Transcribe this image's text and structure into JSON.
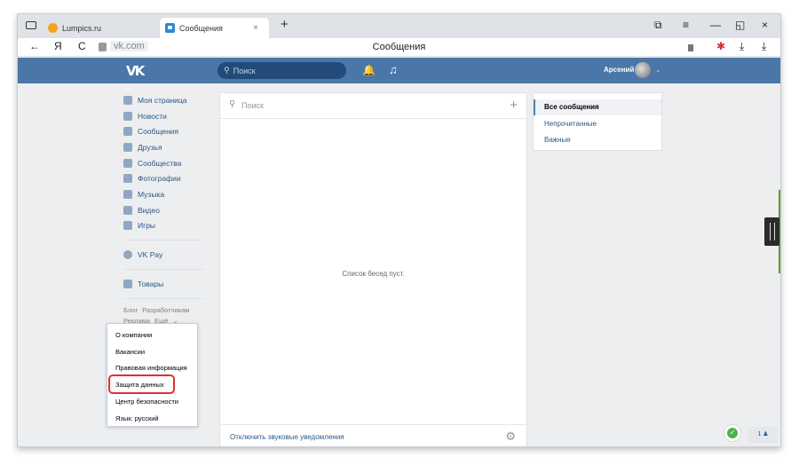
{
  "browser": {
    "tabs": [
      {
        "label": "Lumpics.ru",
        "icon": "lumpics-favicon"
      },
      {
        "label": "Сообщения",
        "icon": "vk-favicon"
      }
    ],
    "tab_close_glyph": "×",
    "new_tab_glyph": "+",
    "address": {
      "domain": "vk.com",
      "page_title": "Сообщения",
      "back_glyph": "←",
      "yandex_glyph": "Я",
      "reload_glyph": "C"
    },
    "window_controls": {
      "list": "≡",
      "minimize": "—",
      "restore": "◱",
      "close": "×",
      "pin": "⧉"
    },
    "toolbar_icons": {
      "bug": "✱",
      "save": "⤓",
      "download": "⤓"
    }
  },
  "vk_header": {
    "logo": "VK",
    "search_placeholder": "Поиск",
    "search_glyph": "⚲",
    "bell_glyph": "🔔",
    "music_glyph": "♫",
    "user_name": "Арсений",
    "caret": "⌄"
  },
  "left_nav": {
    "items": [
      {
        "label": "Моя страница",
        "icon": "home-icon"
      },
      {
        "label": "Новости",
        "icon": "news-icon"
      },
      {
        "label": "Сообщения",
        "icon": "messages-icon"
      },
      {
        "label": "Друзья",
        "icon": "friends-icon"
      },
      {
        "label": "Сообщества",
        "icon": "communities-icon"
      },
      {
        "label": "Фотографии",
        "icon": "photos-icon"
      },
      {
        "label": "Музыка",
        "icon": "music-icon"
      },
      {
        "label": "Видео",
        "icon": "video-icon"
      },
      {
        "label": "Игры",
        "icon": "games-icon"
      }
    ],
    "vkpay": {
      "label": "VK Pay",
      "icon": "vkpay-icon"
    },
    "goods": {
      "label": "Товары",
      "icon": "goods-icon"
    },
    "small_links": {
      "blog": "Блог",
      "developers": "Разработчикам",
      "ads": "Реклама",
      "more": "Ещё"
    }
  },
  "dropdown": {
    "items": [
      "О компании",
      "Вакансии",
      "Правовая информация",
      "Защита данных",
      "Центр безопасности",
      "Язык: русский"
    ]
  },
  "messages": {
    "search_placeholder": "Поиск",
    "search_glyph": "⚲",
    "add_glyph": "+",
    "empty_text": "Список бесед пуст.",
    "footer_label": "Отключить звуковые уведомления",
    "gear_glyph": "⚙"
  },
  "filters": {
    "items": [
      {
        "label": "Все сообщения",
        "active": true
      },
      {
        "label": "Непрочитанные",
        "active": false
      },
      {
        "label": "Важные",
        "active": false
      }
    ]
  },
  "bottom_right": {
    "shield_glyph": "✓",
    "pager_label": "1 ♟"
  }
}
